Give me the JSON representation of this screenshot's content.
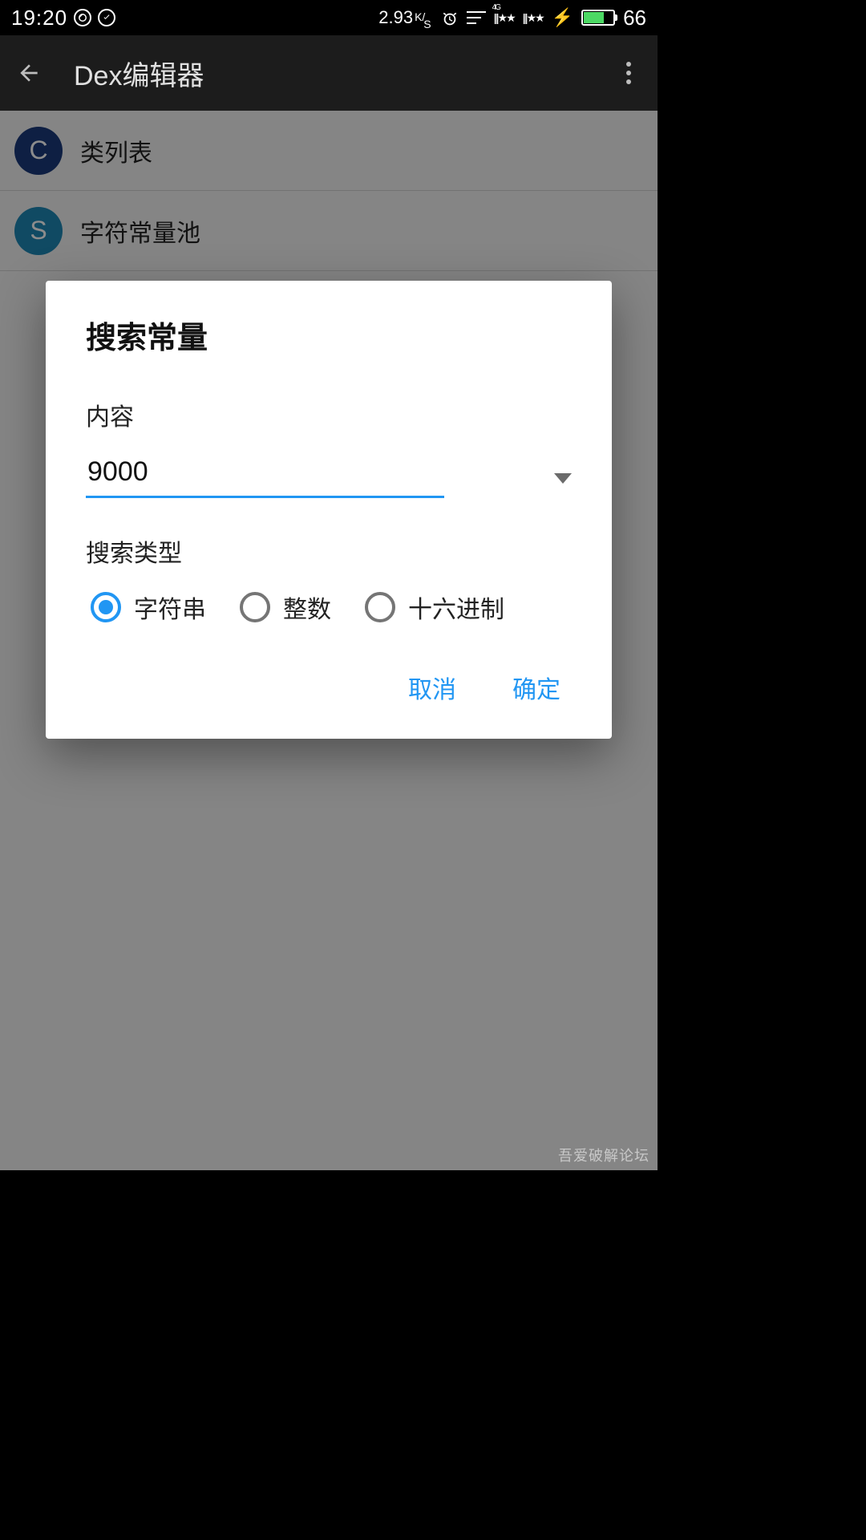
{
  "status": {
    "time": "19:20",
    "speed_value": "2.93",
    "speed_unit_top": "K",
    "speed_unit_bottom": "S",
    "battery_pct": "66"
  },
  "appbar": {
    "title": "Dex编辑器"
  },
  "list": {
    "items": [
      {
        "avatar_letter": "C",
        "avatar_bg": "#1a3a7a",
        "label": "类列表"
      },
      {
        "avatar_letter": "S",
        "avatar_bg": "#1e88b5",
        "label": "字符常量池"
      }
    ]
  },
  "dialog": {
    "title": "搜索常量",
    "content_label": "内容",
    "input_value": "9000",
    "type_label": "搜索类型",
    "radios": [
      {
        "label": "字符串",
        "checked": true
      },
      {
        "label": "整数",
        "checked": false
      },
      {
        "label": "十六进制",
        "checked": false
      }
    ],
    "cancel": "取消",
    "ok": "确定"
  },
  "watermark": "吾爱破解论坛"
}
